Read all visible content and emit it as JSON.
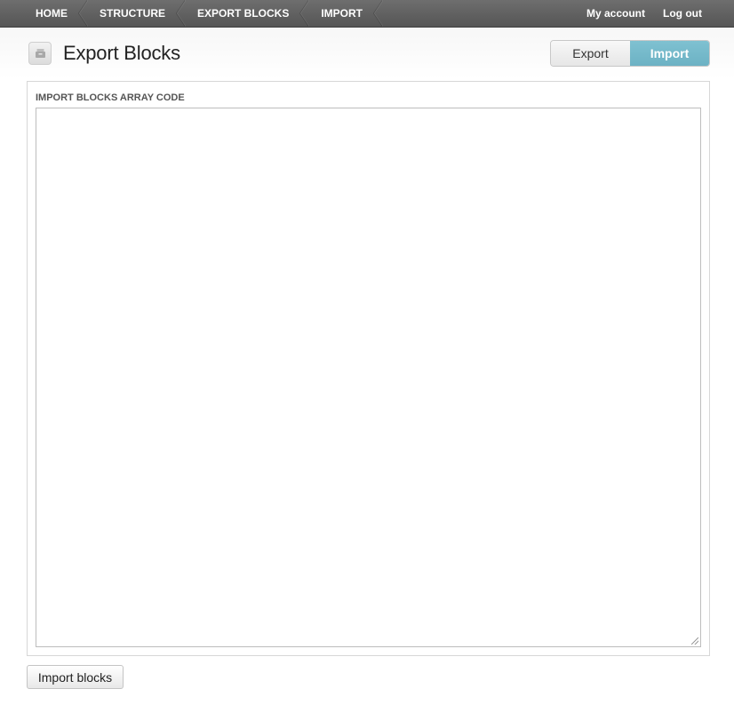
{
  "breadcrumbs": [
    {
      "label": "HOME"
    },
    {
      "label": "STRUCTURE"
    },
    {
      "label": "EXPORT BLOCKS"
    },
    {
      "label": "IMPORT"
    }
  ],
  "account": {
    "my_account": "My account",
    "log_out": "Log out"
  },
  "header": {
    "title": "Export Blocks",
    "icon": "package-icon"
  },
  "tabs": [
    {
      "label": "Export",
      "active": false
    },
    {
      "label": "Import",
      "active": true
    }
  ],
  "form": {
    "field_label": "IMPORT BLOCKS ARRAY CODE",
    "textarea_value": "",
    "submit_label": "Import blocks"
  },
  "colors": {
    "toolbar": "#5f5f5f",
    "active_tab": "#72b8c9",
    "text": "#222222"
  }
}
